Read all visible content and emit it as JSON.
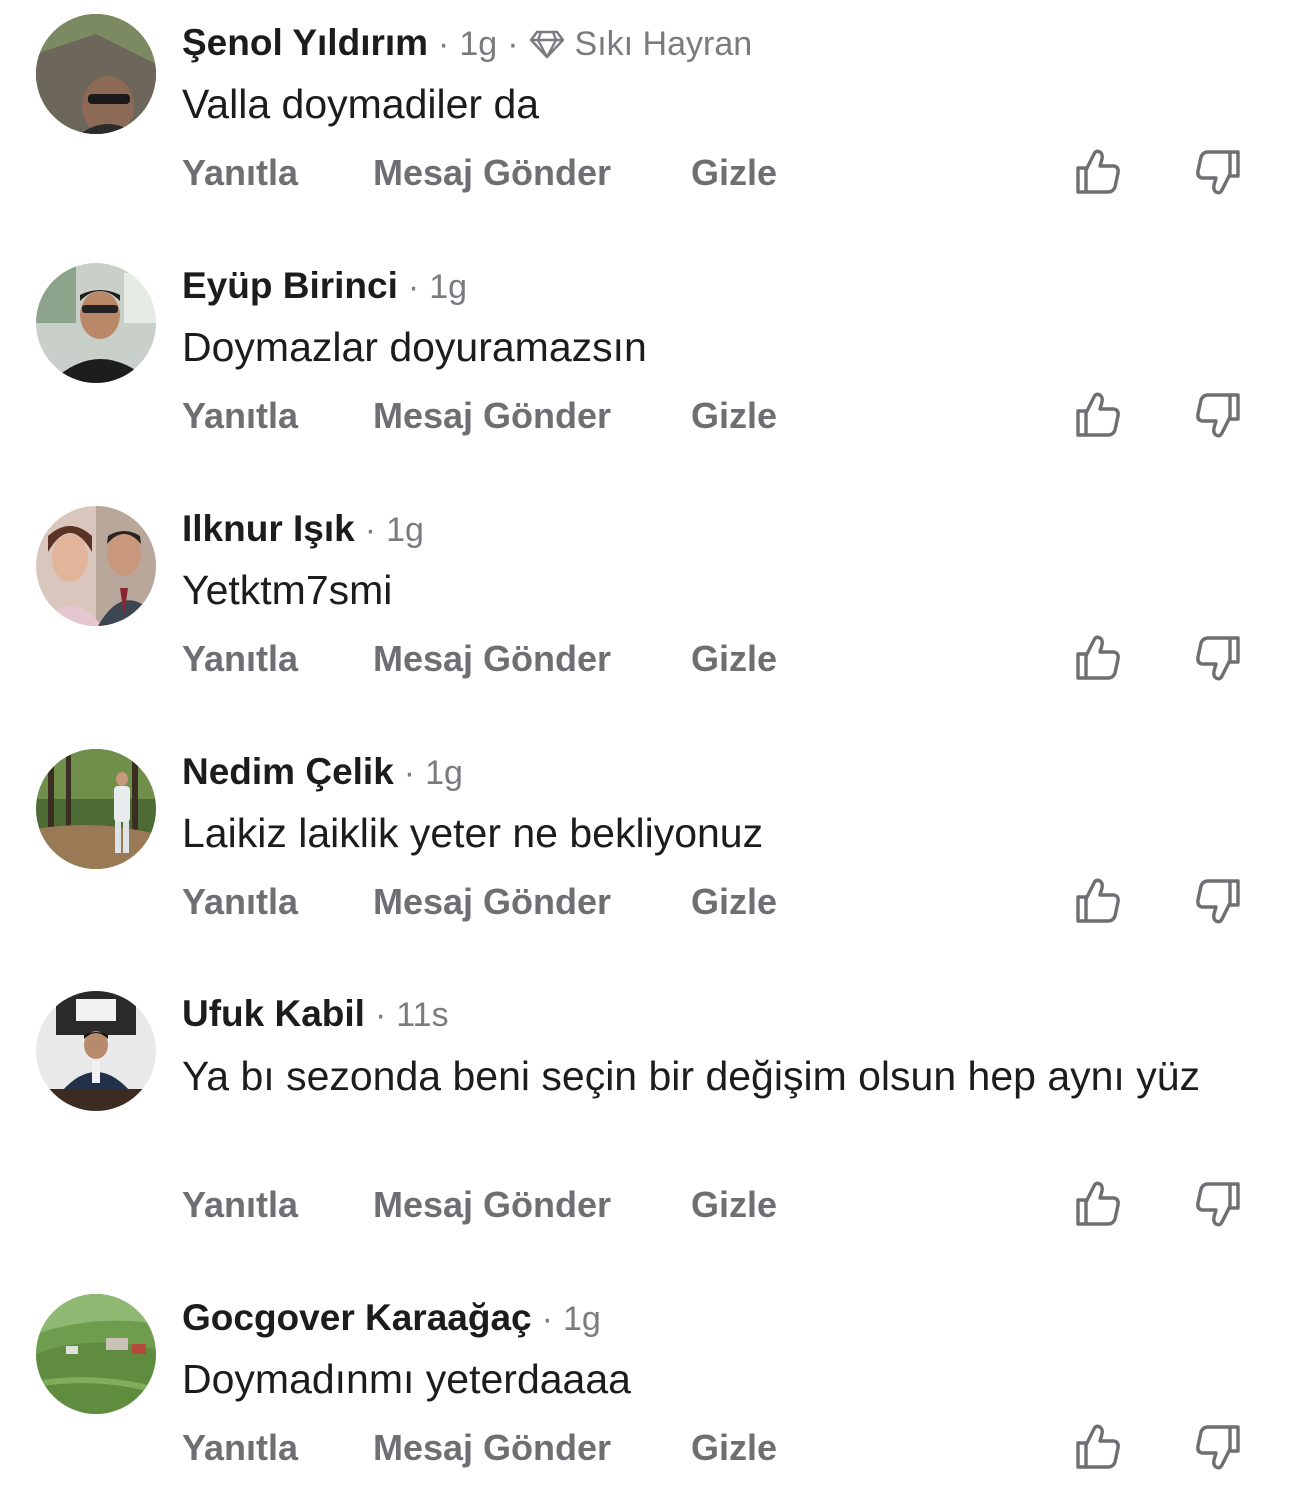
{
  "actions": {
    "reply": "Yanıtla",
    "message": "Mesaj Gönder",
    "hide": "Gizle",
    "like_icon": "thumbs-up-icon",
    "dislike_icon": "thumbs-down-icon"
  },
  "separator": "·",
  "comments": [
    {
      "author": "Şenol Yıldırım",
      "time": "1g",
      "badge": "Sıkı Hayran",
      "badge_icon": "diamond-icon",
      "text": "Valla doymadiler da"
    },
    {
      "author": "Eyüp Birinci",
      "time": "1g",
      "text": "Doymazlar doyuramazsın"
    },
    {
      "author": "Ilknur Işık",
      "time": "1g",
      "text": "Yetktm7smi"
    },
    {
      "author": "Nedim Çelik",
      "time": "1g",
      "text": "Laikiz laiklik yeter ne bekliyonuz"
    },
    {
      "author": "Ufuk Kabil",
      "time": "11s",
      "text": "Ya bı sezonda beni seçin bir değişim olsun  hep aynı yüz"
    },
    {
      "author": "Gocgover Karaağaç",
      "time": "1g",
      "text": "Doymadınmı yeterdaaaa"
    }
  ],
  "colors": {
    "text": "#1c1c1e",
    "meta": "#7a7a80",
    "action": "#6e6e73"
  }
}
